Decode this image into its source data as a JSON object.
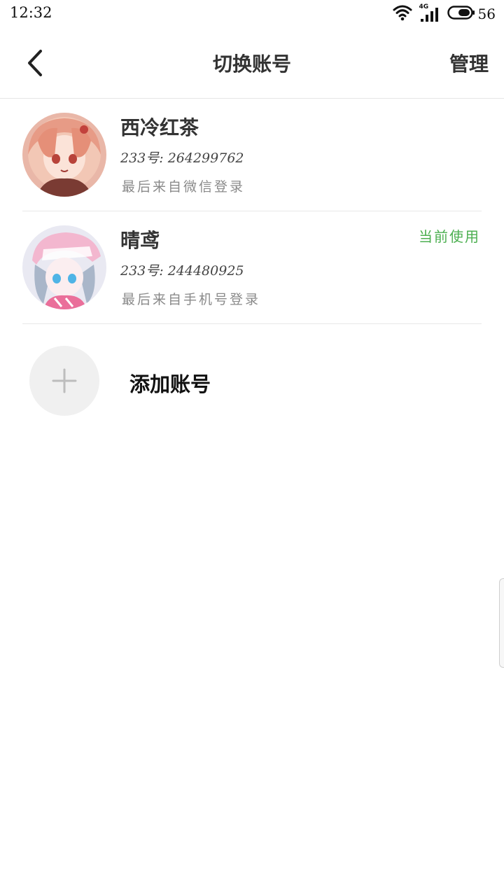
{
  "status_bar": {
    "time": "12:32",
    "network": "4G",
    "battery": "56"
  },
  "nav": {
    "title": "切换账号",
    "manage_label": "管理"
  },
  "accounts": [
    {
      "name": "西冷红茶",
      "id_text": "233号: 264299762",
      "login_text": "最后来自微信登录",
      "current_label": ""
    },
    {
      "name": "晴鸢",
      "id_text": "233号: 244480925",
      "login_text": "最后来自手机号登录",
      "current_label": "当前使用"
    }
  ],
  "add_account": {
    "label": "添加账号"
  },
  "colors": {
    "accent_green": "#4caf50",
    "title_text": "#333333",
    "secondary_text": "#8a8a8a",
    "divider": "#e8e8e8"
  },
  "icons": {
    "back": "chevron-left-icon",
    "wifi": "wifi-icon",
    "signal": "signal-icon",
    "battery": "battery-icon",
    "add": "plus-icon"
  }
}
